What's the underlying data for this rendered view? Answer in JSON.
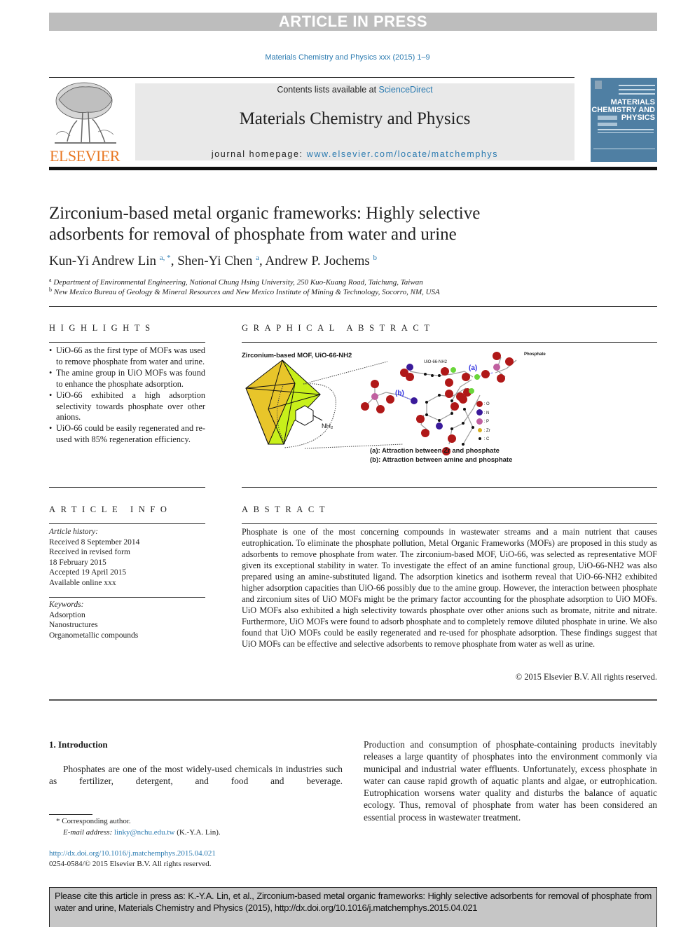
{
  "banner": "ARTICLE IN PRESS",
  "journal_citation": "Materials Chemistry and Physics xxx (2015) 1–9",
  "header": {
    "contents_prefix": "Contents lists available at ",
    "contents_link": "ScienceDirect",
    "journal_title": "Materials Chemistry and Physics",
    "homepage_prefix": "journal homepage: ",
    "homepage_link": "www.elsevier.com/locate/matchemphys",
    "publisher_logo_text": "ELSEVIER",
    "cover": {
      "line1": "MATERIALS",
      "line2": "CHEMISTRY AND",
      "line3": "PHYSICS"
    }
  },
  "colors": {
    "link": "#2a7ab0",
    "elsevier_orange": "#e87722",
    "cover_blue": "#4f7fa3",
    "banner_gray": "#bdbdbd"
  },
  "article": {
    "title_line1": "Zirconium-based metal organic frameworks: Highly selective",
    "title_line2": "adsorbents for removal of phosphate from water and urine",
    "authors": [
      {
        "name": "Kun-Yi Andrew Lin",
        "sup": "a, *"
      },
      {
        "name": "Shen-Yi Chen",
        "sup": "a"
      },
      {
        "name": "Andrew P. Jochems",
        "sup": "b"
      }
    ],
    "affiliations": [
      {
        "mark": "a",
        "text": "Department of Environmental Engineering, National Chung Hsing University, 250 Kuo-Kuang Road, Taichung, Taiwan"
      },
      {
        "mark": "b",
        "text": "New Mexico Bureau of Geology & Mineral Resources and New Mexico Institute of Mining & Technology, Socorro, NM, USA"
      }
    ]
  },
  "highlights": {
    "heading": "HIGHLIGHTS",
    "items": [
      "UiO-66 as the first type of MOFs was used to remove phosphate from water and urine.",
      "The amine group in UiO MOFs was found to enhance the phosphate adsorption.",
      "UiO-66 exhibited a high adsorption selectivity towards phosphate over other anions.",
      "UiO-66 could be easily regenerated and re-used with 85% regeneration efficiency."
    ]
  },
  "graphical_abstract": {
    "heading": "GRAPHICAL ABSTRACT",
    "figure_title": "Zirconium-based MOF, UiO-66-NH2",
    "molecule_label": "UiO-66-NH2",
    "phosphate_label": "Phosphate",
    "nh2_label": "NH2",
    "label_a": "(a)",
    "label_b": "(b)",
    "legend": [
      {
        "symbol": "O",
        "color": "#b01818"
      },
      {
        "symbol": "N",
        "color": "#3a1a9a"
      },
      {
        "symbol": "P",
        "color": "#c060a0"
      },
      {
        "symbol": "Zr",
        "color": "#d8b020"
      },
      {
        "symbol": "C",
        "color": "#111111"
      }
    ],
    "caption_a": "(a): Attraction between Zr and phosphate",
    "caption_b": "(b): Attraction between amine and phosphate"
  },
  "article_info": {
    "heading": "ARTICLE INFO",
    "history_label": "Article history:",
    "history": [
      "Received 8 September 2014",
      "Received in revised form",
      "18 February 2015",
      "Accepted 19 April 2015",
      "Available online xxx"
    ],
    "keywords_label": "Keywords:",
    "keywords": [
      "Adsorption",
      "Nanostructures",
      "Organometallic compounds"
    ]
  },
  "abstract": {
    "heading": "ABSTRACT",
    "text": "Phosphate is one of the most concerning compounds in wastewater streams and a main nutrient that causes eutrophication. To eliminate the phosphate pollution, Metal Organic Frameworks (MOFs) are proposed in this study as adsorbents to remove phosphate from water. The zirconium-based MOF, UiO-66, was selected as representative MOF given its exceptional stability in water. To investigate the effect of an amine functional group, UiO-66-NH2 was also prepared using an amine-substituted ligand. The adsorption kinetics and isotherm reveal that UiO-66-NH2 exhibited higher adsorption capacities than UiO-66 possibly due to the amine group. However, the interaction between phosphate and zirconium sites of UiO MOFs might be the primary factor accounting for the phosphate adsorption to UiO MOFs. UiO MOFs also exhibited a high selectivity towards phosphate over other anions such as bromate, nitrite and nitrate. Furthermore, UiO MOFs were found to adsorb phosphate and to completely remove diluted phosphate in urine. We also found that UiO MOFs could be easily regenerated and re-used for phosphate adsorption. These findings suggest that UiO MOFs can be effective and selective adsorbents to remove phosphate from water as well as urine.",
    "copyright": "© 2015 Elsevier B.V. All rights reserved."
  },
  "introduction": {
    "heading": "1.  Introduction",
    "left_text": "Phosphates are one of the most widely-used chemicals in industries such as fertilizer, detergent, and food and beverage.",
    "right_text": "Production and consumption of phosphate-containing products inevitably releases a large quantity of phosphates into the environment commonly via municipal and industrial water effluents. Unfortunately, excess phosphate in water can cause rapid growth of aquatic plants and algae, or eutrophication. Eutrophication worsens water quality and disturbs the balance of aquatic ecology. Thus, removal of phosphate from water has been considered an essential process in wastewater treatment."
  },
  "footnotes": {
    "corresponding": "* Corresponding author.",
    "email_label": "E-mail address: ",
    "email": "linky@nchu.edu.tw",
    "email_suffix": " (K.-Y.A. Lin).",
    "doi": "http://dx.doi.org/10.1016/j.matchemphys.2015.04.021",
    "issn": "0254-0584/© 2015 Elsevier B.V. All rights reserved."
  },
  "cite_box": "Please cite this article in press as: K.-Y.A. Lin, et al., Zirconium-based metal organic frameworks: Highly selective adsorbents for removal of phosphate from water and urine, Materials Chemistry and Physics (2015), http://dx.doi.org/10.1016/j.matchemphys.2015.04.021"
}
